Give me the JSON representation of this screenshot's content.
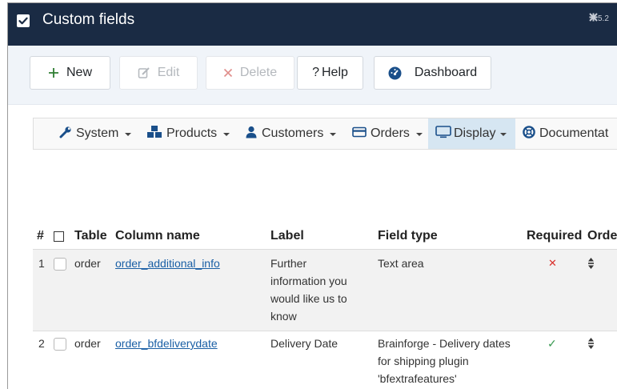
{
  "window": {
    "title": "Custom fields",
    "version": "5.2"
  },
  "toolbar": {
    "new_label": "New",
    "edit_label": "Edit",
    "delete_label": "Delete",
    "help_label": "Help",
    "dashboard_label": "Dashboard"
  },
  "menu": {
    "items": [
      {
        "label": "System",
        "icon": "wrench-icon"
      },
      {
        "label": "Products",
        "icon": "cubes-icon"
      },
      {
        "label": "Customers",
        "icon": "user-icon"
      },
      {
        "label": "Orders",
        "icon": "credit-card-icon"
      },
      {
        "label": "Display",
        "icon": "monitor-icon",
        "active": true
      },
      {
        "label": "Documentat",
        "icon": "lifebuoy-icon"
      }
    ]
  },
  "table": {
    "headers": {
      "num": "#",
      "table": "Table",
      "column": "Column name",
      "label": "Label",
      "type": "Field type",
      "required": "Required",
      "order": "Orde"
    },
    "rows": [
      {
        "num": "1",
        "table": "order",
        "column": "order_additional_info",
        "label_lines": [
          "Further",
          "information you",
          "would like us to",
          "know"
        ],
        "type_lines": [
          "Text area"
        ],
        "required": "✕"
      },
      {
        "num": "2",
        "table": "order",
        "column": "order_bfdeliverydate",
        "label_lines": [
          "Delivery Date"
        ],
        "type_lines": [
          "Brainforge - Delivery dates",
          "for shipping plugin",
          "'bfextrafeatures'"
        ],
        "required": "✓"
      }
    ]
  },
  "colors": {
    "titlebar": "#1a2b44",
    "link": "#1a5fa5",
    "required_no": "#d9302c",
    "required_yes": "#3a9a52",
    "active_menu": "#d6e6f2"
  }
}
